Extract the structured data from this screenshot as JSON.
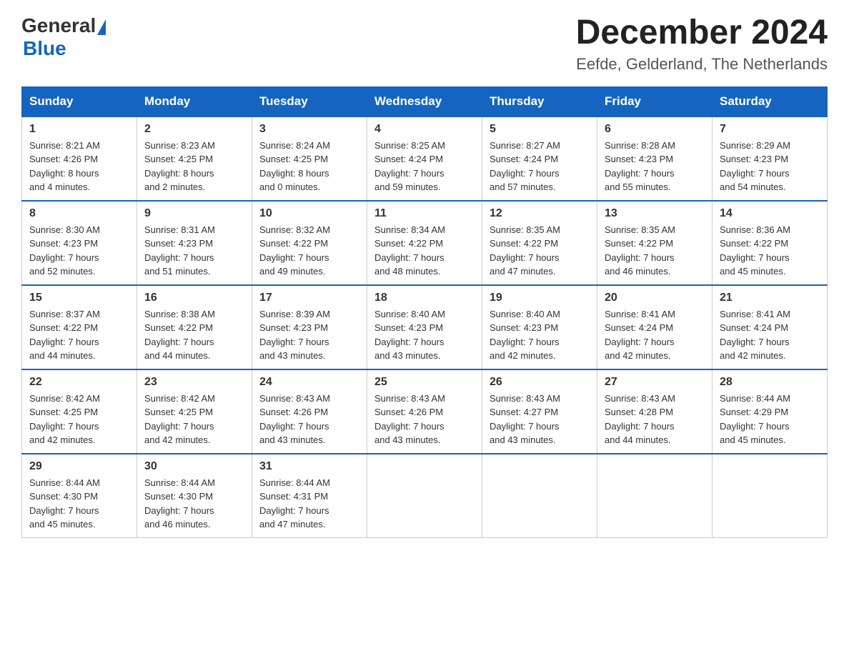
{
  "header": {
    "logo_general": "General",
    "logo_blue": "Blue",
    "month_year": "December 2024",
    "location": "Eefde, Gelderland, The Netherlands"
  },
  "columns": [
    "Sunday",
    "Monday",
    "Tuesday",
    "Wednesday",
    "Thursday",
    "Friday",
    "Saturday"
  ],
  "weeks": [
    [
      {
        "day": "1",
        "sunrise": "8:21 AM",
        "sunset": "4:26 PM",
        "daylight": "8 hours and 4 minutes."
      },
      {
        "day": "2",
        "sunrise": "8:23 AM",
        "sunset": "4:25 PM",
        "daylight": "8 hours and 2 minutes."
      },
      {
        "day": "3",
        "sunrise": "8:24 AM",
        "sunset": "4:25 PM",
        "daylight": "8 hours and 0 minutes."
      },
      {
        "day": "4",
        "sunrise": "8:25 AM",
        "sunset": "4:24 PM",
        "daylight": "7 hours and 59 minutes."
      },
      {
        "day": "5",
        "sunrise": "8:27 AM",
        "sunset": "4:24 PM",
        "daylight": "7 hours and 57 minutes."
      },
      {
        "day": "6",
        "sunrise": "8:28 AM",
        "sunset": "4:23 PM",
        "daylight": "7 hours and 55 minutes."
      },
      {
        "day": "7",
        "sunrise": "8:29 AM",
        "sunset": "4:23 PM",
        "daylight": "7 hours and 54 minutes."
      }
    ],
    [
      {
        "day": "8",
        "sunrise": "8:30 AM",
        "sunset": "4:23 PM",
        "daylight": "7 hours and 52 minutes."
      },
      {
        "day": "9",
        "sunrise": "8:31 AM",
        "sunset": "4:23 PM",
        "daylight": "7 hours and 51 minutes."
      },
      {
        "day": "10",
        "sunrise": "8:32 AM",
        "sunset": "4:22 PM",
        "daylight": "7 hours and 49 minutes."
      },
      {
        "day": "11",
        "sunrise": "8:34 AM",
        "sunset": "4:22 PM",
        "daylight": "7 hours and 48 minutes."
      },
      {
        "day": "12",
        "sunrise": "8:35 AM",
        "sunset": "4:22 PM",
        "daylight": "7 hours and 47 minutes."
      },
      {
        "day": "13",
        "sunrise": "8:35 AM",
        "sunset": "4:22 PM",
        "daylight": "7 hours and 46 minutes."
      },
      {
        "day": "14",
        "sunrise": "8:36 AM",
        "sunset": "4:22 PM",
        "daylight": "7 hours and 45 minutes."
      }
    ],
    [
      {
        "day": "15",
        "sunrise": "8:37 AM",
        "sunset": "4:22 PM",
        "daylight": "7 hours and 44 minutes."
      },
      {
        "day": "16",
        "sunrise": "8:38 AM",
        "sunset": "4:22 PM",
        "daylight": "7 hours and 44 minutes."
      },
      {
        "day": "17",
        "sunrise": "8:39 AM",
        "sunset": "4:23 PM",
        "daylight": "7 hours and 43 minutes."
      },
      {
        "day": "18",
        "sunrise": "8:40 AM",
        "sunset": "4:23 PM",
        "daylight": "7 hours and 43 minutes."
      },
      {
        "day": "19",
        "sunrise": "8:40 AM",
        "sunset": "4:23 PM",
        "daylight": "7 hours and 42 minutes."
      },
      {
        "day": "20",
        "sunrise": "8:41 AM",
        "sunset": "4:24 PM",
        "daylight": "7 hours and 42 minutes."
      },
      {
        "day": "21",
        "sunrise": "8:41 AM",
        "sunset": "4:24 PM",
        "daylight": "7 hours and 42 minutes."
      }
    ],
    [
      {
        "day": "22",
        "sunrise": "8:42 AM",
        "sunset": "4:25 PM",
        "daylight": "7 hours and 42 minutes."
      },
      {
        "day": "23",
        "sunrise": "8:42 AM",
        "sunset": "4:25 PM",
        "daylight": "7 hours and 42 minutes."
      },
      {
        "day": "24",
        "sunrise": "8:43 AM",
        "sunset": "4:26 PM",
        "daylight": "7 hours and 43 minutes."
      },
      {
        "day": "25",
        "sunrise": "8:43 AM",
        "sunset": "4:26 PM",
        "daylight": "7 hours and 43 minutes."
      },
      {
        "day": "26",
        "sunrise": "8:43 AM",
        "sunset": "4:27 PM",
        "daylight": "7 hours and 43 minutes."
      },
      {
        "day": "27",
        "sunrise": "8:43 AM",
        "sunset": "4:28 PM",
        "daylight": "7 hours and 44 minutes."
      },
      {
        "day": "28",
        "sunrise": "8:44 AM",
        "sunset": "4:29 PM",
        "daylight": "7 hours and 45 minutes."
      }
    ],
    [
      {
        "day": "29",
        "sunrise": "8:44 AM",
        "sunset": "4:30 PM",
        "daylight": "7 hours and 45 minutes."
      },
      {
        "day": "30",
        "sunrise": "8:44 AM",
        "sunset": "4:30 PM",
        "daylight": "7 hours and 46 minutes."
      },
      {
        "day": "31",
        "sunrise": "8:44 AM",
        "sunset": "4:31 PM",
        "daylight": "7 hours and 47 minutes."
      },
      null,
      null,
      null,
      null
    ]
  ],
  "labels": {
    "sunrise": "Sunrise:",
    "sunset": "Sunset:",
    "daylight": "Daylight:"
  }
}
